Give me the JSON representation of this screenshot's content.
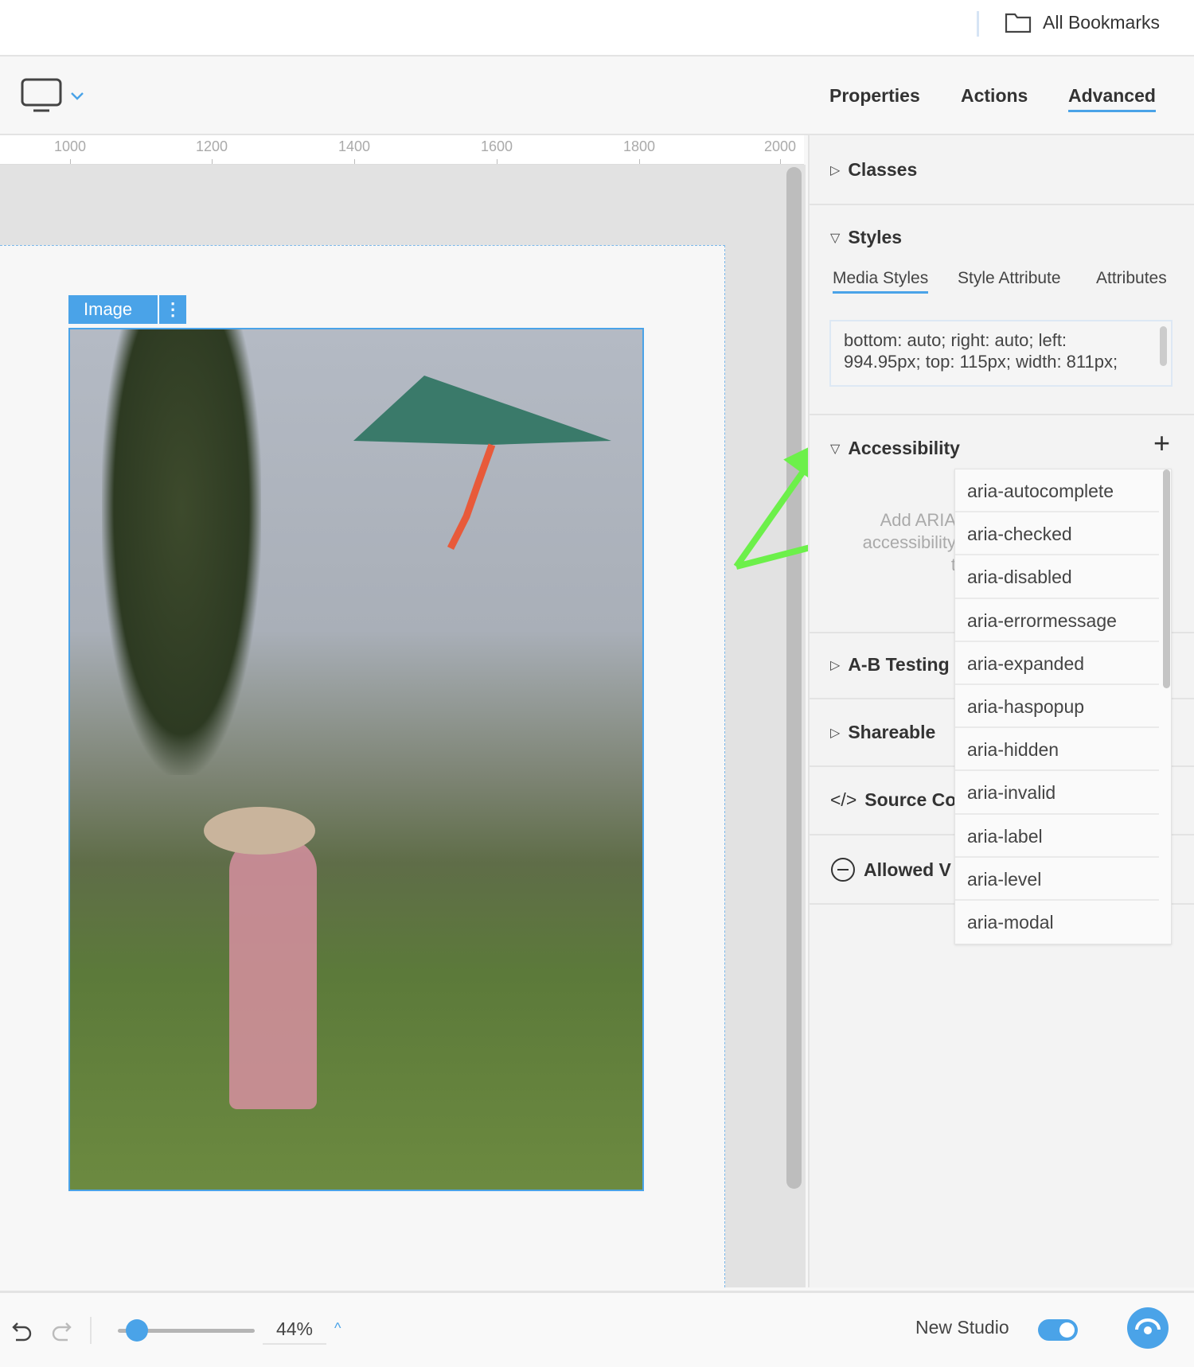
{
  "topbar": {
    "bookmarks_label": "All Bookmarks"
  },
  "toolbar": {
    "tabs": [
      {
        "label": "Properties"
      },
      {
        "label": "Actions"
      },
      {
        "label": "Advanced",
        "active": true
      }
    ]
  },
  "ruler": {
    "labels": [
      "1000",
      "1200",
      "1400",
      "1600",
      "1800",
      "2000"
    ]
  },
  "canvas": {
    "selected_label": "Image"
  },
  "panel": {
    "classes": "Classes",
    "styles": "Styles",
    "style_tabs": [
      "Media Styles",
      "Style Attribute",
      "Attributes"
    ],
    "style_text": "bottom: auto; right: auto; left: 994.95px; top: 115px; width: 811px;",
    "accessibility": "Accessibility",
    "accessibility_placeholder": [
      "Add ARIA",
      "accessibility",
      "t"
    ],
    "ab_testing": "A-B Testing",
    "shareable": "Shareable",
    "source_code": "Source Co",
    "allowed": "Allowed V",
    "aria_options": [
      "aria-autocomplete",
      "aria-checked",
      "aria-disabled",
      "aria-errormessage",
      "aria-expanded",
      "aria-haspopup",
      "aria-hidden",
      "aria-invalid",
      "aria-label",
      "aria-level",
      "aria-modal"
    ]
  },
  "bottombar": {
    "zoom": "44%",
    "zoom_fraction": 0.15,
    "new_studio_label": "New Studio",
    "new_studio_on": true
  },
  "colors": {
    "accent": "#4aa3e8",
    "arrow": "#6cf04a"
  }
}
